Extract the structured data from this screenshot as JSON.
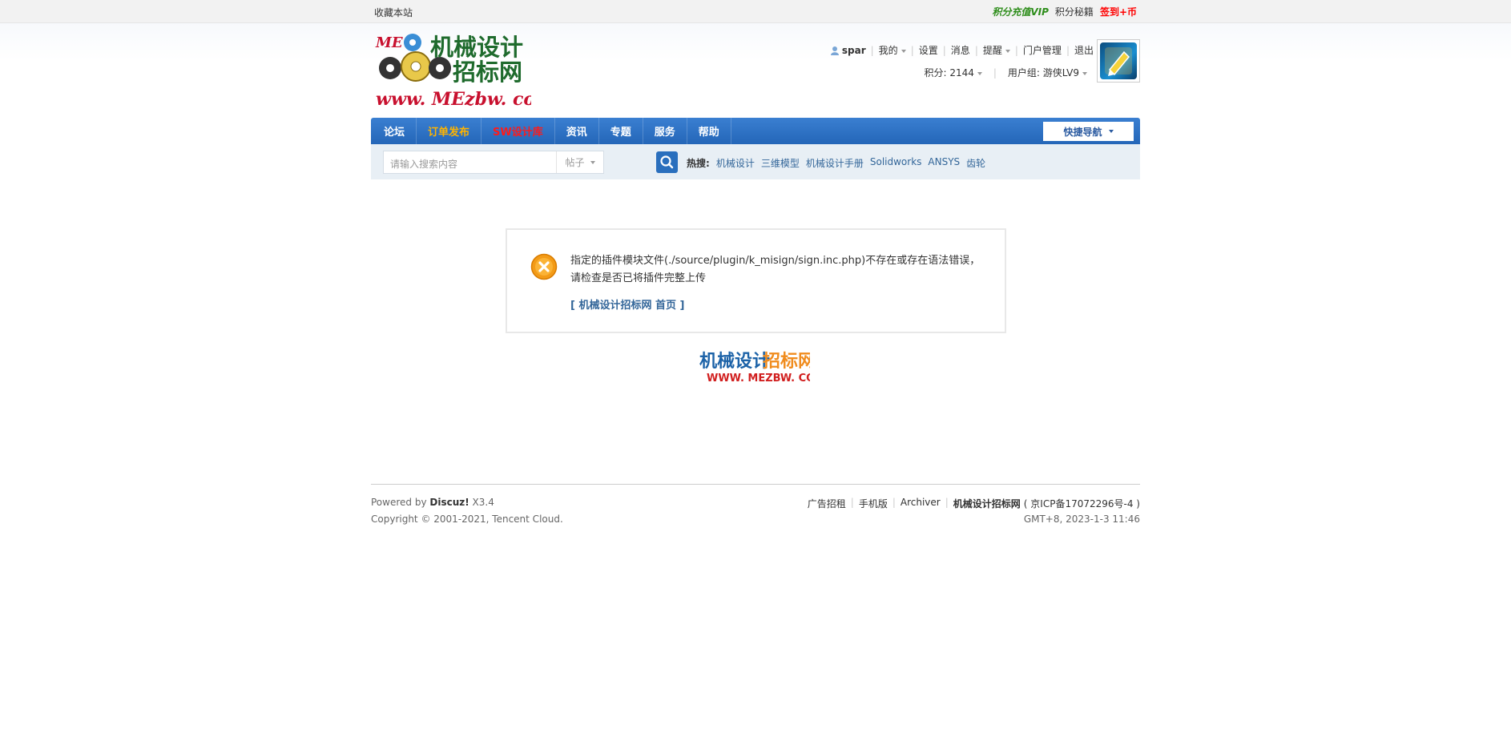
{
  "toolbar": {
    "favorite": "收藏本站",
    "vip": "积分充值VIP",
    "secret": "积分秘籍",
    "sign": "签到+币"
  },
  "logo": {
    "line1": "机械设计",
    "line2": "招标网",
    "url": "www. MEzbw. com"
  },
  "user_menu": {
    "username": "spar",
    "mine": "我的",
    "settings": "设置",
    "messages": "消息",
    "reminders": "提醒",
    "portal_admin": "门户管理",
    "logout": "退出",
    "points": "积分: 2144",
    "usergroup": "用户组: 游侠LV9"
  },
  "nav": {
    "items": [
      "论坛",
      "订单发布",
      "SW设计库",
      "资讯",
      "专题",
      "服务",
      "帮助"
    ],
    "quick": "快捷导航"
  },
  "search": {
    "placeholder": "请输入搜索内容",
    "type": "帖子",
    "hot_label": "热搜:",
    "hot": [
      "机械设计",
      "三维模型",
      "机械设计手册",
      "Solidworks",
      "ANSYS",
      "齿轮"
    ]
  },
  "message": {
    "text": "指定的插件模块文件(./source/plugin/k_misign/sign.inc.php)不存在或存在语法错误，请检查是否已将插件完整上传",
    "home_link": "[ 机械设计招标网 首页 ]"
  },
  "brand2": {
    "cn_blue": "机械设计",
    "cn_orange": "招标网",
    "url": "WWW. MEZBW. COM"
  },
  "footer": {
    "powered_prefix": "Powered by ",
    "powered_name": "Discuz!",
    "powered_version": " X3.4",
    "copyright": "Copyright © 2001-2021, Tencent Cloud.",
    "links": [
      "广告招租",
      "手机版",
      "Archiver"
    ],
    "site_name": "机械设计招标网",
    "icp": "( 京ICP备17072296号-4 )",
    "time": "GMT+8, 2023-1-3 11:46"
  }
}
